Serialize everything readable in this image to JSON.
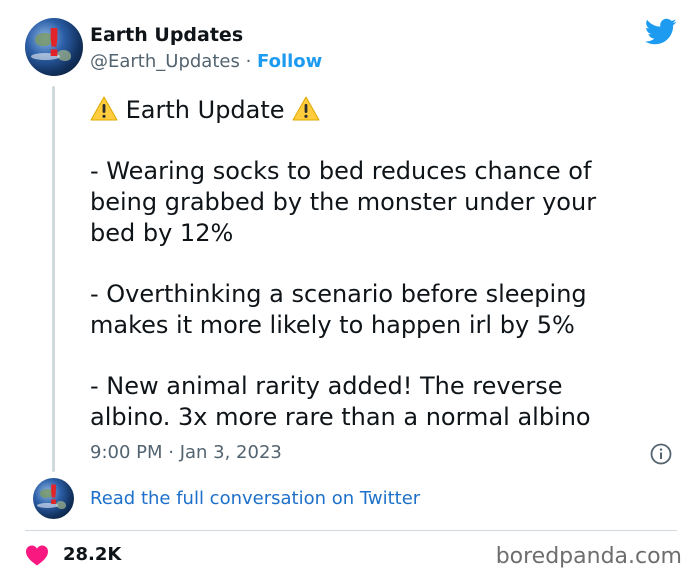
{
  "author": {
    "name": "Earth Updates",
    "handle": "@Earth_Updates",
    "separator": " · ",
    "follow_label": "Follow"
  },
  "tweet": {
    "title": "Earth Update",
    "paragraphs": [
      [
        "- Wearing socks to bed reduces chance of",
        "being grabbed by the monster under your",
        "bed by 12%"
      ],
      [
        "- Overthinking a scenario before sleeping",
        "makes it more likely to happen irl by 5%"
      ],
      [
        "- New animal rarity added! The reverse",
        "albino. 3x more rare than a normal albino"
      ]
    ],
    "timestamp": "9:00 PM · Jan 3, 2023"
  },
  "conversation_link": "Read the full conversation on Twitter",
  "likes_count": "28.2K",
  "watermark": "boredpanda.com",
  "colors": {
    "accent": "#1d9bf0",
    "link": "#1d70c9",
    "heart": "#f91880",
    "muted": "#536471"
  },
  "icons": [
    "twitter-bird-icon",
    "warning-icon",
    "info-icon",
    "heart-icon"
  ]
}
